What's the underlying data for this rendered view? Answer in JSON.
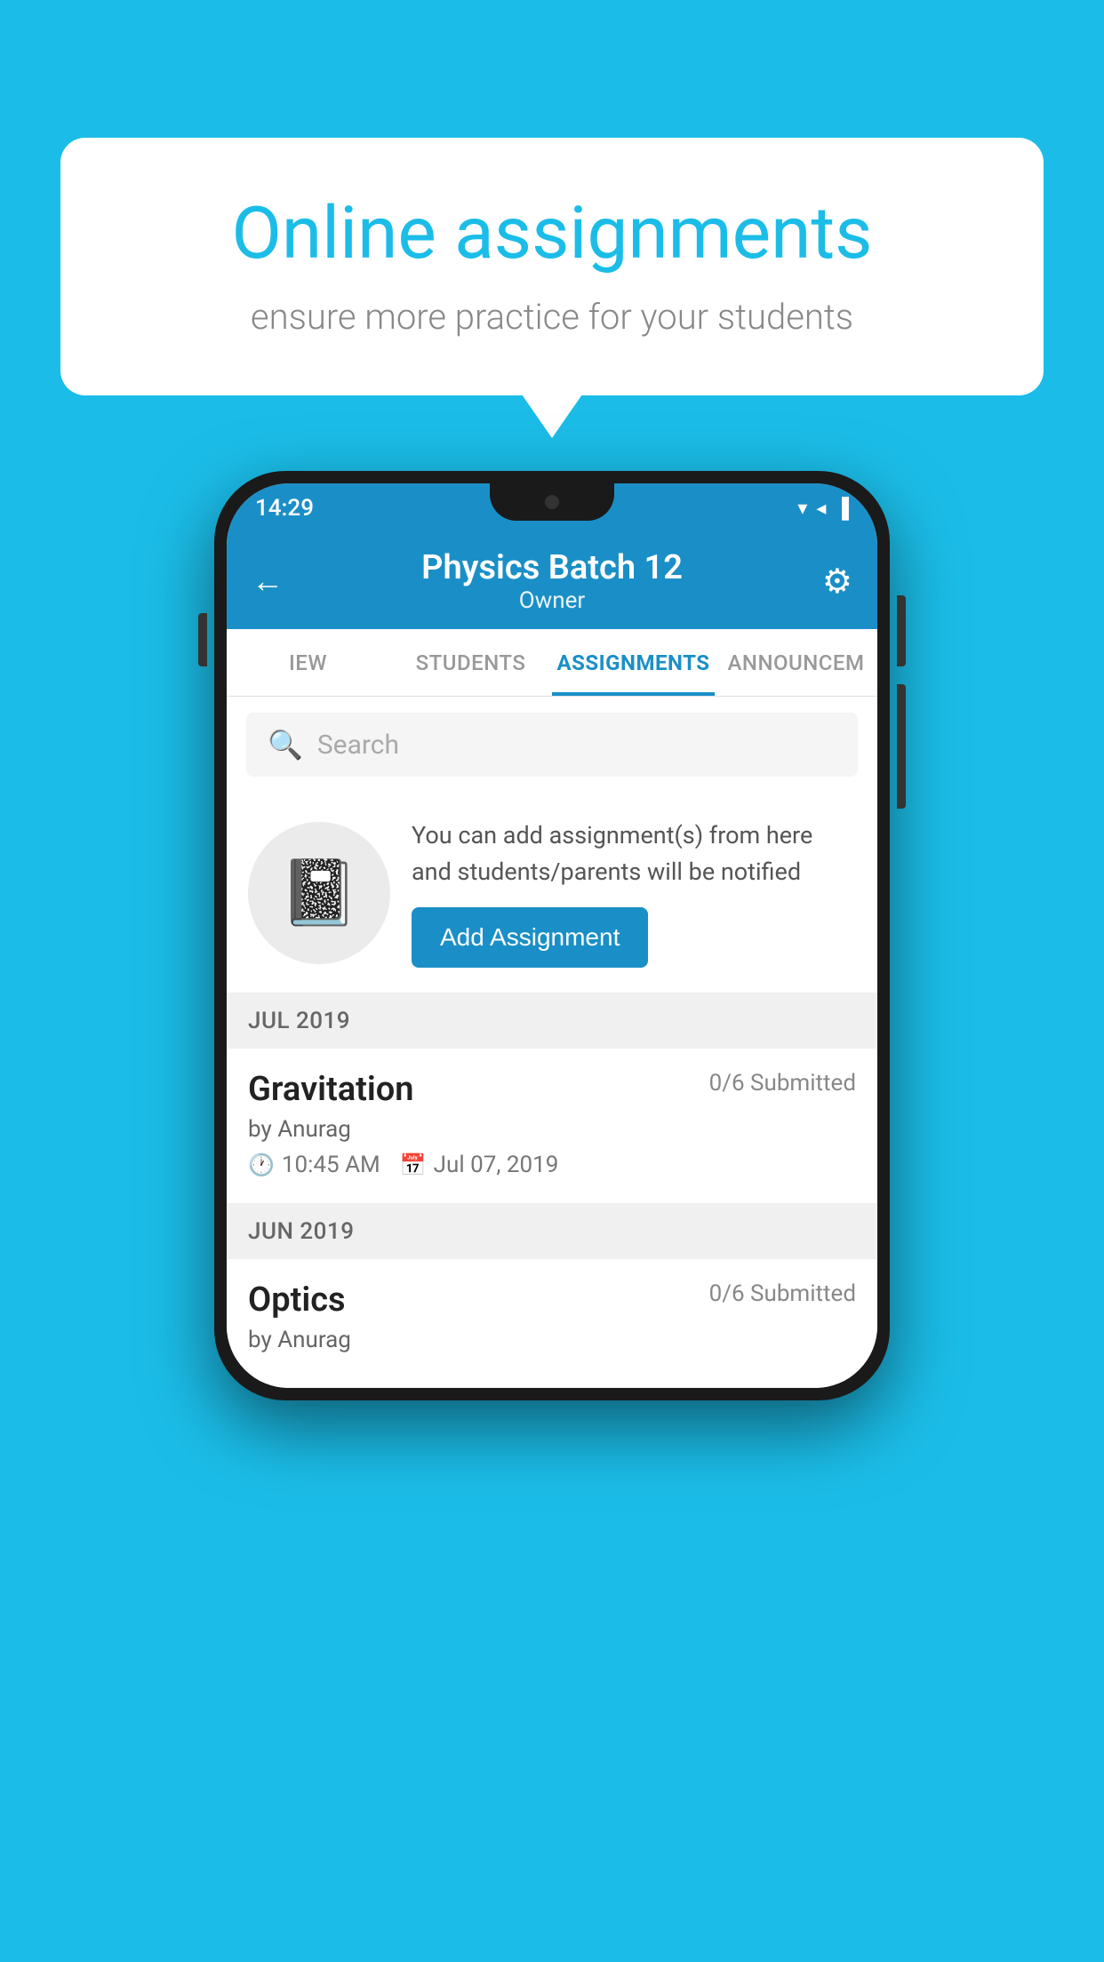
{
  "background_color": "#1BBDE8",
  "speech_bubble": {
    "title": "Online assignments",
    "subtitle": "ensure more practice for your students"
  },
  "phone": {
    "status_bar": {
      "time": "14:29",
      "icons": [
        "▼",
        "◀",
        "▐"
      ]
    },
    "app_bar": {
      "title": "Physics Batch 12",
      "subtitle": "Owner",
      "back_label": "←",
      "settings_label": "⚙"
    },
    "tabs": [
      {
        "label": "IEW",
        "active": false
      },
      {
        "label": "STUDENTS",
        "active": false
      },
      {
        "label": "ASSIGNMENTS",
        "active": true
      },
      {
        "label": "ANNOUNCEM",
        "active": false
      }
    ],
    "search": {
      "placeholder": "Search"
    },
    "promo": {
      "description": "You can add assignment(s) from here and students/parents will be notified",
      "button_label": "Add Assignment"
    },
    "sections": [
      {
        "month_label": "JUL 2019",
        "assignments": [
          {
            "name": "Gravitation",
            "submitted": "0/6 Submitted",
            "by": "by Anurag",
            "time": "10:45 AM",
            "date": "Jul 07, 2019"
          }
        ]
      },
      {
        "month_label": "JUN 2019",
        "assignments": [
          {
            "name": "Optics",
            "submitted": "0/6 Submitted",
            "by": "by Anurag",
            "time": "",
            "date": ""
          }
        ]
      }
    ]
  }
}
